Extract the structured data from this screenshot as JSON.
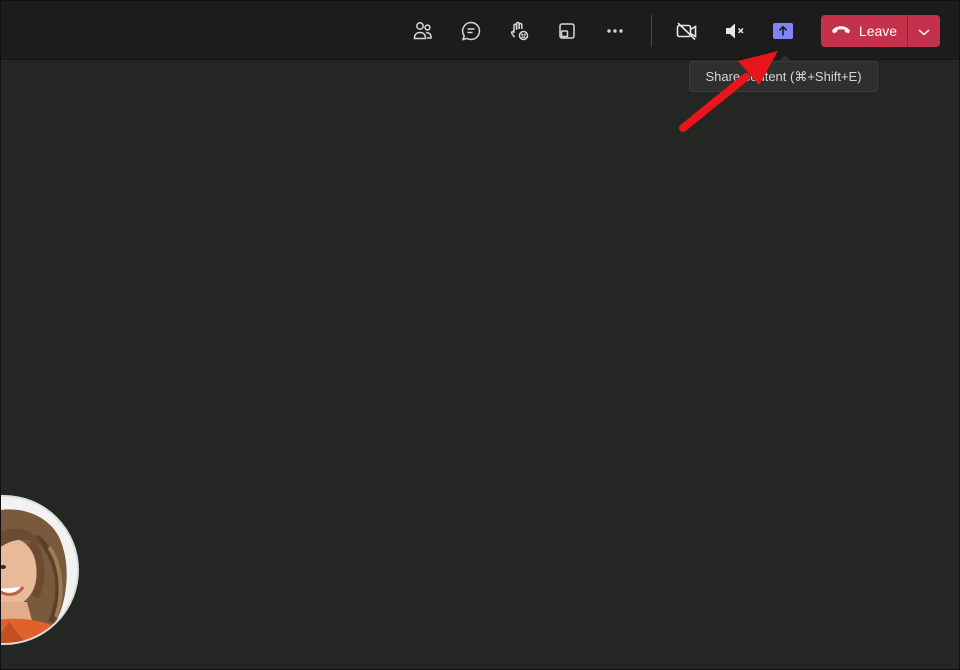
{
  "toolbar": {
    "people_icon": "people-icon",
    "chat_icon": "chat-icon",
    "reactions_icon": "raise-hand-icon",
    "view_icon": "view-layout-icon",
    "more_icon": "more-actions-icon",
    "camera_icon": "camera-off-icon",
    "mic_icon": "speaker-muted-icon",
    "share_icon": "share-content-icon",
    "leave_label": "Leave",
    "leave_icon": "phone-hangup-icon",
    "leave_dropdown_icon": "chevron-down-icon"
  },
  "tooltip": {
    "text": "Share content (⌘+Shift+E)"
  },
  "colors": {
    "leave_red": "#c4314b",
    "share_accent": "#7f85f5",
    "icon_gray": "#d6d6d6"
  },
  "participant": {
    "avatar": "participant-avatar"
  }
}
